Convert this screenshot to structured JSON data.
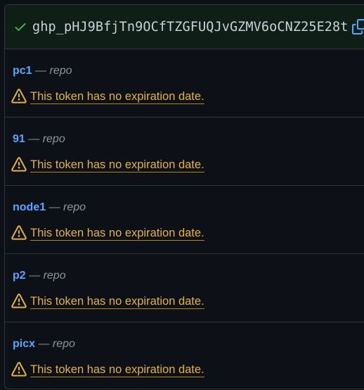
{
  "new_token": {
    "value": "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",
    "status_icon": "check-icon",
    "copy_icon": "copy-icon"
  },
  "colors": {
    "background": "#0d1117",
    "token_row_bg": "#0f1e17",
    "link": "#58a6ff",
    "warning": "#e3b341",
    "success": "#3fb950",
    "muted": "#8b949e"
  },
  "tokens": [
    {
      "name": "pc1",
      "separator": "—",
      "scope": "repo",
      "warning": "This token has no expiration date."
    },
    {
      "name": "91",
      "separator": "—",
      "scope": "repo",
      "warning": "This token has no expiration date."
    },
    {
      "name": "node1",
      "separator": "—",
      "scope": "repo",
      "warning": "This token has no expiration date."
    },
    {
      "name": "p2",
      "separator": "—",
      "scope": "repo",
      "warning": "This token has no expiration date."
    },
    {
      "name": "picx",
      "separator": "—",
      "scope": "repo",
      "warning": "This token has no expiration date."
    }
  ]
}
